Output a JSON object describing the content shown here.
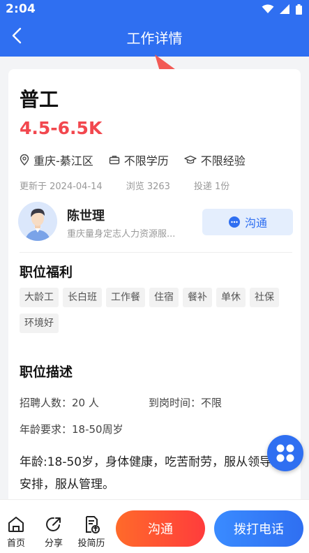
{
  "status_bar": {
    "time": "2:04",
    "icons": [
      "wifi-icon",
      "signal-icon",
      "battery-icon"
    ]
  },
  "header": {
    "title": "工作详情",
    "back_icon": "back-arrow-icon"
  },
  "job": {
    "title": "普工",
    "salary": "4.5-6.5K",
    "location": "重庆-綦江区",
    "education": "不限学历",
    "experience": "不限经验",
    "updated": "更新于 2024-04-14",
    "views": "浏览 3263",
    "applications": "投递 1份"
  },
  "recruiter": {
    "name": "陈世理",
    "company": "重庆量身定志人力资源服...",
    "chat_label": "沟通"
  },
  "benefits": {
    "title": "职位福利",
    "tags": [
      "大龄工",
      "长白班",
      "工作餐",
      "住宿",
      "餐补",
      "单休",
      "社保",
      "环境好"
    ]
  },
  "description": {
    "title": "职位描述",
    "headcount": "招聘人数：20 人",
    "arrival": "到岗时间：不限",
    "age": "年龄要求：18-50周岁",
    "text": "年龄:18-50岁，身体健康，吃苦耐劳，服从领导的安排，服从管理。"
  },
  "bottom_bar": {
    "home": "首页",
    "share": "分享",
    "resume": "投简历",
    "chat": "沟通",
    "call": "拨打电话"
  },
  "colors": {
    "primary": "#2f6ff1",
    "salary": "#f2474e",
    "chat_gradient_start": "#ff6a2a",
    "chat_gradient_end": "#ff3c3c"
  }
}
